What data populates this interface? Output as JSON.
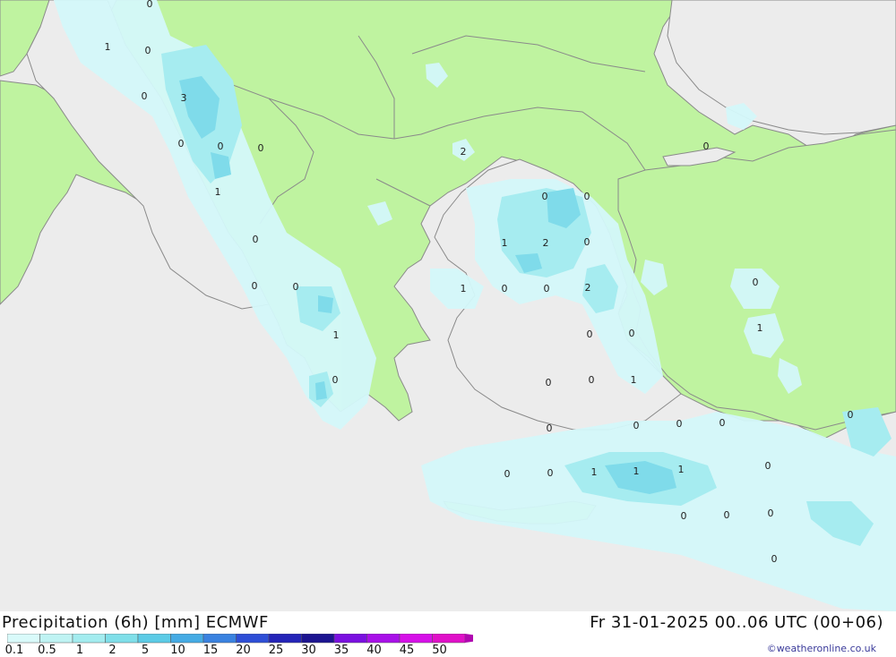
{
  "title": "Precipitation (6h) [mm] ECMWF",
  "datetime": "Fr 31-01-2025 00..06 UTC (00+06)",
  "copyright": "©weatheronline.co.uk",
  "legend": {
    "ticks": [
      "0.1",
      "0.5",
      "1",
      "2",
      "5",
      "10",
      "15",
      "20",
      "25",
      "30",
      "35",
      "40",
      "45",
      "50"
    ],
    "colors": [
      "#d9fafa",
      "#bff3f3",
      "#a3ecef",
      "#7fdfe9",
      "#5ccbe6",
      "#45abe4",
      "#3a82e0",
      "#2e4ed6",
      "#2424b8",
      "#1c1490",
      "#7a10e0",
      "#a810e8",
      "#d610e8",
      "#e010c8",
      "#b008b0"
    ]
  },
  "map": {
    "colors": {
      "sea": "#ececec",
      "land": "#bff3a0",
      "border": "#8a8a8a",
      "precip_light": "#d4f8fa",
      "precip_mid": "#a6ecf0",
      "precip_heavy": "#7fdbea"
    },
    "labels": [
      "0",
      "1",
      "0",
      "0",
      "3",
      "0",
      "0",
      "0",
      "1",
      "2",
      "0",
      "0",
      "0",
      "1",
      "2",
      "0",
      "1",
      "0",
      "0",
      "2",
      "0",
      "0",
      "1",
      "0",
      "0",
      "0",
      "0",
      "1",
      "0",
      "0",
      "0",
      "0",
      "0",
      "1",
      "1",
      "1",
      "0",
      "0",
      "0",
      "0",
      "1",
      "0",
      "0",
      "0",
      "0",
      "0",
      "0"
    ]
  }
}
